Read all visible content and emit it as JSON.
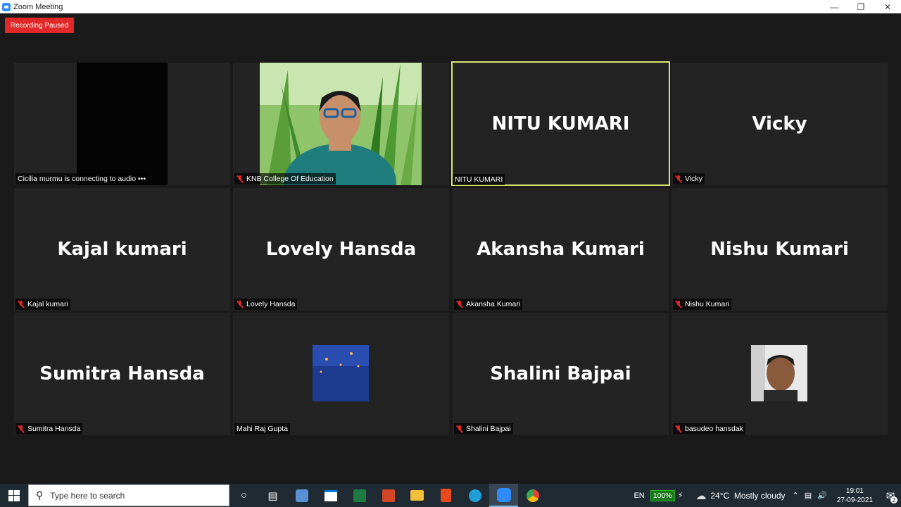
{
  "window": {
    "title": "Zoom Meeting"
  },
  "meeting": {
    "recording_badge": "Recording Paused",
    "tiles": [
      {
        "label": "Cicilia murmu is connecting to audio •••",
        "big": "",
        "muted": false,
        "video": "black"
      },
      {
        "label": "KNB College Of Education",
        "big": "",
        "muted": true,
        "video": "person-grass"
      },
      {
        "label": "NITU KUMARI",
        "big": "NITU KUMARI",
        "muted": false,
        "active": true
      },
      {
        "label": "Vicky",
        "big": "Vicky",
        "muted": true
      },
      {
        "label": "Kajal kumari",
        "big": "Kajal kumari",
        "muted": true
      },
      {
        "label": "Lovely Hansda",
        "big": "Lovely Hansda",
        "muted": true
      },
      {
        "label": "Akansha Kumari",
        "big": "Akansha Kumari",
        "muted": true
      },
      {
        "label": "Nishu Kumari",
        "big": "Nishu Kumari",
        "muted": true
      },
      {
        "label": "Sumitra Hansda",
        "big": "Sumitra Hansda",
        "muted": true
      },
      {
        "label": "Mahi Raj Gupta",
        "big": "",
        "muted": false,
        "video": "moon-avatar"
      },
      {
        "label": "Shalini Bajpai",
        "big": "Shalini Bajpai",
        "muted": true
      },
      {
        "label": "basudeo hansdak",
        "big": "",
        "muted": true,
        "video": "man-avatar"
      }
    ]
  },
  "taskbar": {
    "search_placeholder": "Type here to search",
    "language": "EN",
    "battery": "100%",
    "weather": "24°C  Mostly cloudy",
    "time": "19:01",
    "date": "27-09-2021",
    "notifications": "2"
  }
}
